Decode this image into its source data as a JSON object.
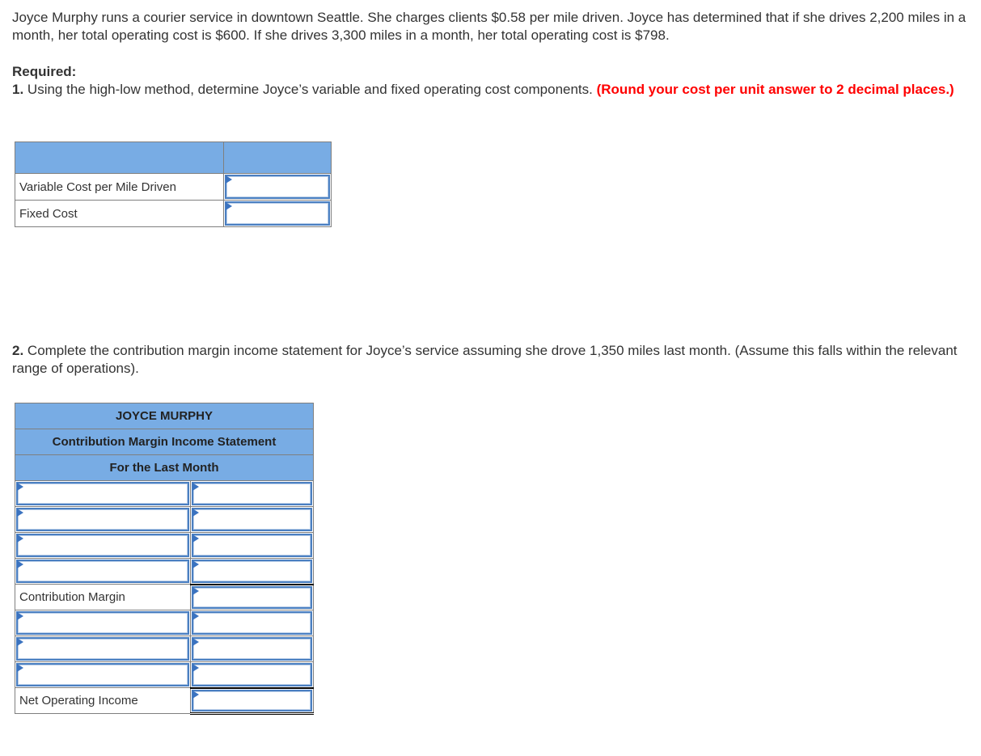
{
  "problem": {
    "intro": "Joyce Murphy runs a courier service in downtown Seattle. She charges clients $0.58 per mile driven. Joyce has determined that if she drives 2,200 miles in a month, her total operating cost is $600. If she drives 3,300 miles in a month, her total operating cost is $798.",
    "required_label": "Required:",
    "q1_number": "1.",
    "q1_text": " Using the high-low method, determine Joyce’s variable and fixed operating cost components. ",
    "q1_note": "(Round your cost per unit answer to 2 decimal places.)",
    "q2_number": "2.",
    "q2_text": " Complete the contribution margin income statement for Joyce’s service assuming she drove 1,350 miles last month. (Assume this falls within the relevant range of operations)."
  },
  "table1": {
    "header": [
      "",
      ""
    ],
    "rows": [
      {
        "label": "Variable Cost per Mile Driven",
        "value": ""
      },
      {
        "label": "Fixed Cost",
        "value": ""
      }
    ]
  },
  "table2": {
    "title": "JOYCE MURPHY",
    "subtitle": "Contribution Margin Income Statement",
    "period": "For the Last Month",
    "rows": [
      {
        "label": "",
        "value": "",
        "label_editable": true
      },
      {
        "label": "",
        "value": "",
        "label_editable": true
      },
      {
        "label": "",
        "value": "",
        "label_editable": true
      },
      {
        "label": "",
        "value": "",
        "label_editable": true
      },
      {
        "label": "Contribution Margin",
        "value": "",
        "label_editable": false
      },
      {
        "label": "",
        "value": "",
        "label_editable": true
      },
      {
        "label": "",
        "value": "",
        "label_editable": true
      },
      {
        "label": "",
        "value": "",
        "label_editable": true
      },
      {
        "label": "Net Operating Income",
        "value": "",
        "label_editable": false
      }
    ]
  },
  "colors": {
    "header_fill": "#78ace4",
    "input_border": "#4a7fc1",
    "note_red": "#ff0000"
  }
}
